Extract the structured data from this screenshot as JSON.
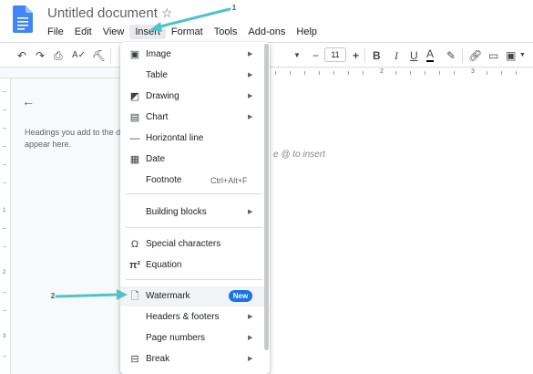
{
  "header": {
    "title": "Untitled document",
    "star_icon": "star-outline-icon",
    "logo_icon": "google-docs-icon"
  },
  "menubar": {
    "items": [
      "File",
      "Edit",
      "View",
      "Insert",
      "Format",
      "Tools",
      "Add-ons",
      "Help"
    ],
    "active": "Insert"
  },
  "toolbar": {
    "font_size": "11",
    "minus": "−",
    "plus": "+",
    "bold": "B",
    "italic": "I",
    "underline": "U",
    "text_color": "A"
  },
  "ruler": {
    "numbers": [
      "1",
      "2",
      "3"
    ]
  },
  "outline": {
    "text": "Headings you add to the document will appear here.",
    "line1": "Headings you add to the d",
    "line2": "appear here."
  },
  "document": {
    "placeholder": "e @ to insert"
  },
  "insert_menu": {
    "items": [
      {
        "icon": "image-icon",
        "label": "Image",
        "submenu": true
      },
      {
        "icon": "",
        "label": "Table",
        "submenu": true
      },
      {
        "icon": "drawing-icon",
        "label": "Drawing",
        "submenu": true
      },
      {
        "icon": "chart-icon",
        "label": "Chart",
        "submenu": true
      },
      {
        "icon": "horizontal-line-icon",
        "label": "Horizontal line",
        "submenu": false
      },
      {
        "icon": "calendar-icon",
        "label": "Date",
        "submenu": false
      },
      {
        "icon": "",
        "label": "Footnote",
        "shortcut": "Ctrl+Alt+F",
        "submenu": false
      },
      {
        "icon": "",
        "label": "Building blocks",
        "submenu": true
      },
      {
        "icon": "omega-icon",
        "label": "Special characters",
        "submenu": false
      },
      {
        "icon": "pi-icon",
        "label": "Equation",
        "submenu": false
      },
      {
        "icon": "watermark-icon",
        "label": "Watermark",
        "badge": "New",
        "submenu": false
      },
      {
        "icon": "",
        "label": "Headers & footers",
        "submenu": true
      },
      {
        "icon": "",
        "label": "Page numbers",
        "submenu": true
      },
      {
        "icon": "break-icon",
        "label": "Break",
        "submenu": true
      }
    ]
  },
  "annotations": {
    "step1": "1",
    "step2": "2",
    "arrow_color": "#4fc3c9"
  },
  "colors": {
    "accent": "#1a73e8",
    "doc_blue": "#4285f4"
  }
}
